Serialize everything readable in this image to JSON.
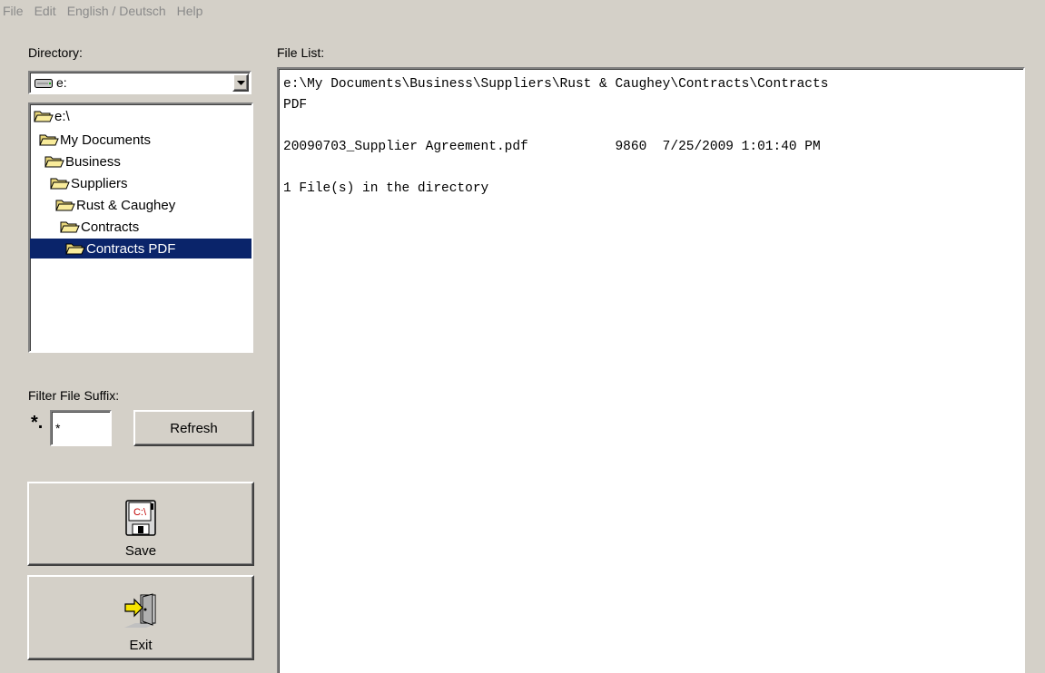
{
  "menu": [
    "File",
    "Edit",
    "English / Deutsch",
    "Help"
  ],
  "directory": {
    "label": "Directory:",
    "drive_value": "e:",
    "tree": [
      {
        "label": "e:\\",
        "selected": false
      },
      {
        "label": "My Documents",
        "selected": false
      },
      {
        "label": "Business",
        "selected": false
      },
      {
        "label": "Suppliers",
        "selected": false
      },
      {
        "label": "Rust & Caughey",
        "selected": false
      },
      {
        "label": "Contracts",
        "selected": false
      },
      {
        "label": "Contracts PDF",
        "selected": true
      }
    ]
  },
  "file_list": {
    "label": "File List:",
    "lines": [
      "e:\\My Documents\\Business\\Suppliers\\Rust & Caughey\\Contracts\\Contracts",
      "PDF",
      "",
      "20090703_Supplier Agreement.pdf           9860  7/25/2009 1:01:40 PM",
      "",
      "1 File(s) in the directory"
    ]
  },
  "filter": {
    "label": "Filter File Suffix:",
    "prefix": "*.",
    "value": "*"
  },
  "buttons": {
    "refresh": "Refresh",
    "save": "Save",
    "save_icon_text": "C:\\",
    "exit": "Exit"
  }
}
